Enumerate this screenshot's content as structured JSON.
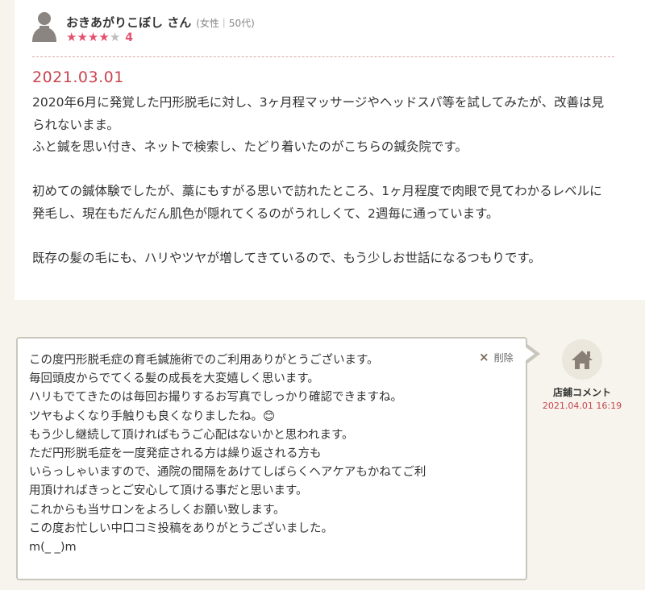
{
  "review": {
    "reviewer_name": "おきあがりこぼし さん",
    "reviewer_meta": "(女性｜50代)",
    "rating": 4,
    "rating_text": "4",
    "stars": [
      "★",
      "★",
      "★",
      "★",
      "★"
    ],
    "date": "2021.03.01",
    "body": "2020年6月に発覚した円形脱毛に対し、3ヶ月程マッサージやヘッドスパ等を試してみたが、改善は見られないまま。\nふと鍼を思い付き、ネットで検索し、たどり着いたのがこちらの鍼灸院です。\n\n初めての鍼体験でしたが、藁にもすがる思いで訪れたところ、1ヶ月程度で肉眼で見てわかるレベルに発毛し、現在もだんだん肌色が隠れてくるのがうれしくて、2週毎に通っています。\n\n既存の髪の毛にも、ハリやツヤが増してきているので、もう少しお世話になるつもりです。"
  },
  "reply": {
    "delete_label": "削除",
    "delete_icon": "×",
    "shop_label": "店鋪コメント",
    "shop_date": "2021.04.01 16:19",
    "body": "この度円形脱毛症の育毛鍼施術でのご利用ありがとうございます。\n毎回頭皮からでてくる髪の成長を大変嬉しく思います。\nハリもでてきたのは毎回お撮りするお写真でしっかり確認できますね。\nツヤもよくなり手触りも良くなりましたね。😊\nもう少し継続して頂ければもうご心配はないかと思われます。\nただ円形脱毛症を一度発症される方は繰り返される方も\nいらっしゃいますので、通院の間隔をあけてしばらくヘアケアもかねてご利\n用頂ければきっとご安心して頂ける事だと思います。\nこれからも当サロンをよろしくお願い致します。\nこの度お忙しい中口コミ投稿をありがとうございました。\nm(_ _)m"
  },
  "icons": {
    "avatar": "user-silhouette-icon",
    "shop": "house-icon",
    "delete": "close-icon"
  },
  "colors": {
    "accent": "#c9444f",
    "star": "#e3516f",
    "background": "#f6f4ec"
  }
}
